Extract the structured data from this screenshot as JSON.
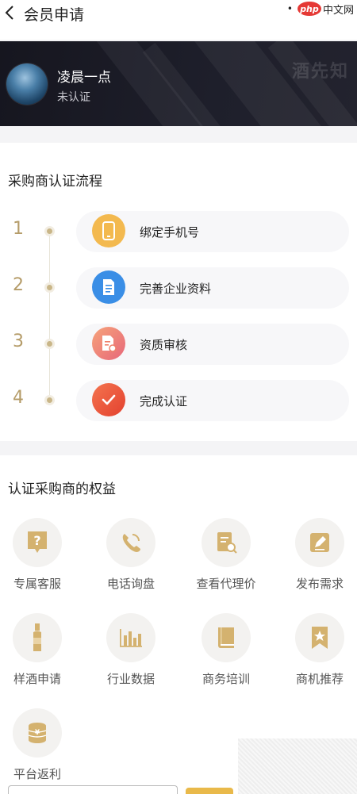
{
  "header": {
    "back_icon": "chevron-left-icon",
    "title": "会员申请",
    "watermark_dot": "•",
    "watermark_logo": "php",
    "watermark_text": "中文网"
  },
  "profile": {
    "name": "凌晨一点",
    "status": "未认证",
    "brand_mark": "酒先知"
  },
  "process": {
    "title": "采购商认证流程",
    "steps": [
      {
        "num": "1",
        "label": "绑定手机号",
        "icon": "phone-icon",
        "color": "#f3b94f"
      },
      {
        "num": "2",
        "label": "完善企业资料",
        "icon": "document-icon",
        "color": "#3a8ee6"
      },
      {
        "num": "3",
        "label": "资质审核",
        "icon": "review-icon",
        "color": "#ef7f6a"
      },
      {
        "num": "4",
        "label": "完成认证",
        "icon": "check-icon",
        "color": "#e9553b"
      }
    ]
  },
  "benefits": {
    "title": "认证采购商的权益",
    "items": [
      {
        "label": "专属客服",
        "icon": "question-bubble-icon"
      },
      {
        "label": "电话询盘",
        "icon": "telephone-icon"
      },
      {
        "label": "查看代理价",
        "icon": "price-search-icon"
      },
      {
        "label": "发布需求",
        "icon": "edit-icon"
      },
      {
        "label": "样酒申请",
        "icon": "bottle-icon"
      },
      {
        "label": "行业数据",
        "icon": "bar-chart-icon"
      },
      {
        "label": "商务培训",
        "icon": "book-icon"
      },
      {
        "label": "商机推荐",
        "icon": "bookmark-star-icon"
      },
      {
        "label": "平台返利",
        "icon": "coin-stack-icon"
      }
    ]
  },
  "colors": {
    "accent_gold": "#c2a46a",
    "banner_dark": "#1a1a24"
  }
}
